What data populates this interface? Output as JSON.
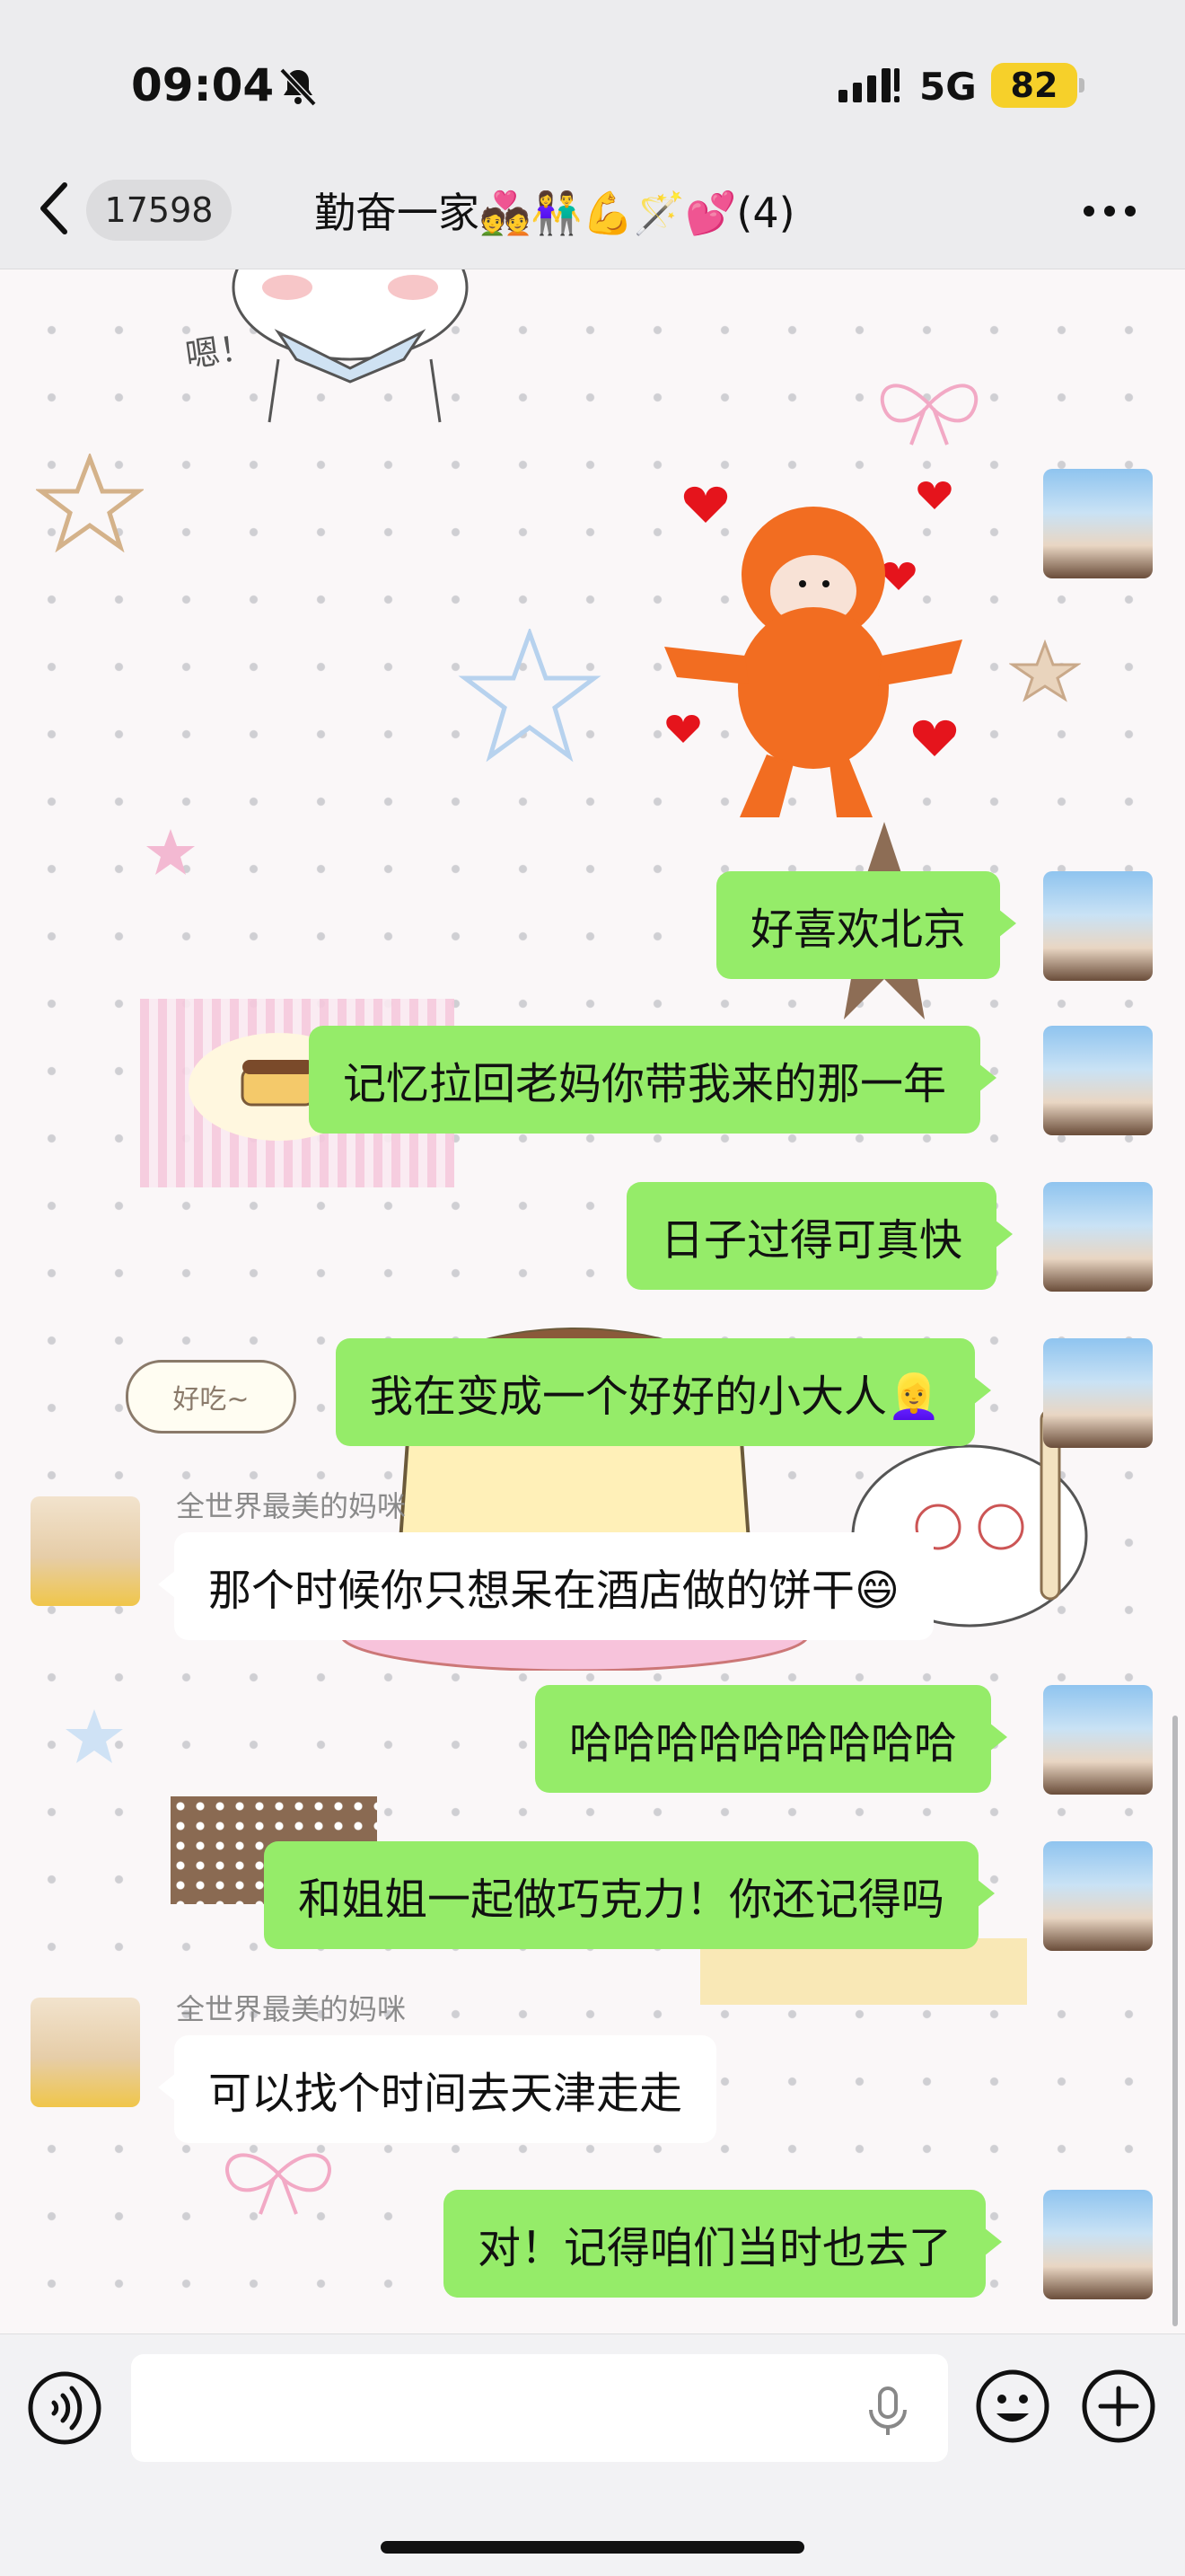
{
  "status_bar": {
    "time": "09:04",
    "network": "5G",
    "battery": "82",
    "icons": [
      "bell-muted-icon",
      "signal-icon"
    ]
  },
  "header": {
    "unread_count": "17598",
    "title": "勤奋一家💑👫💪🪄💕(4)",
    "back_icon": "chevron-left-icon",
    "more_icon": "ellipsis-icon"
  },
  "messages": [
    {
      "from": "self",
      "type": "sticker",
      "sticker": "orange-monkey-hearts-sticker"
    },
    {
      "from": "self",
      "text": "好喜欢北京"
    },
    {
      "from": "self",
      "text": "记忆拉回老妈你带我来的那一年"
    },
    {
      "from": "self",
      "text": "日子过得可真快"
    },
    {
      "from": "self",
      "text": "我在变成一个好好的小大人👱‍♀️"
    },
    {
      "from": "mom",
      "sender": "全世界最美的妈咪",
      "text": "那个时候你只想呆在酒店做的饼干😄"
    },
    {
      "from": "self",
      "text": "哈哈哈哈哈哈哈哈哈"
    },
    {
      "from": "self",
      "text": "和姐姐一起做巧克力！你还记得吗"
    },
    {
      "from": "mom",
      "sender": "全世界最美的妈咪",
      "text": "可以找个时间去天津走走"
    },
    {
      "from": "self",
      "text": "对！记得咱们当时也去了"
    }
  ],
  "background_doodle_text": [
    "嗯！",
    "好吃~"
  ],
  "input_bar": {
    "placeholder": "",
    "voice_icon": "voice-icon",
    "mic_icon": "microphone-icon",
    "emoji_icon": "emoji-icon",
    "plus_icon": "plus-icon"
  },
  "colors": {
    "self_bubble": "#95ec69",
    "mom_bubble": "#ffffff",
    "header_bg": "#ececee",
    "battery": "#f6d02a"
  }
}
